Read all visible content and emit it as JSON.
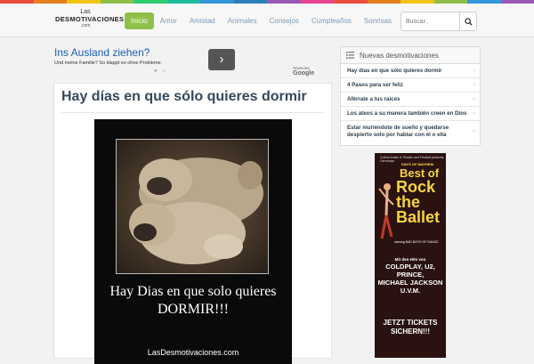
{
  "brand_stripe_colors": [
    "#e74c3c",
    "#e67e22",
    "#f1c40f",
    "#8fc04b",
    "#2ecc71",
    "#1abc9c",
    "#3498db",
    "#2980b9",
    "#9b59b6",
    "#e84393",
    "#e74c3c",
    "#e67e22",
    "#f1c40f",
    "#8fc04b",
    "#3498db",
    "#9b59b6"
  ],
  "header": {
    "logo": {
      "line1": "Las",
      "line2": "DESMOTIVACIONES",
      "line3": ".com"
    },
    "nav": [
      "Inicio",
      "Amor",
      "Amistad",
      "Animales",
      "Consejos",
      "Cumpleaños",
      "Sonrisas"
    ],
    "active_nav_color": "#8fc04b",
    "search_placeholder": "Buscar.."
  },
  "ad_top": {
    "headline": "Ins Ausland ziehen?",
    "subtext": "Und meine Familie? So klappt es ohne Probleme.",
    "arrow": "›",
    "dots": "● ○",
    "by_label": "Anuncios",
    "by_brand": "Google"
  },
  "post": {
    "title": "Hay días en que sólo quieres dormir",
    "caption_line1": "Hay Dias en que solo quieres",
    "caption_line2": "DORMIR!!!",
    "site": "LasDesmotivaciones.com"
  },
  "sidebar": {
    "heading": "Nuevas desmotivaciones",
    "items": [
      "Hay días en que sólo quieres dormir",
      "4 Pasos para ser feliz",
      "Aférrate a tus raices",
      "Los ateos a su manera también creen en Dios",
      "Estar muriéndote de sueño y quedarse despierto solo por hablar con él o ella"
    ]
  },
  "ad_side": {
    "top_line": "Collins Artists & Theater and Festival presents Germanys",
    "show": "DAYS OF MAYHEM",
    "best": "Best of",
    "title_lines": [
      "Rock",
      "the",
      "Ballet"
    ],
    "starring": "starring BAD BOYS OF DANCE",
    "with": "Mit den Hits von",
    "acts": [
      "COLDPLAY, U2,",
      "PRINCE,",
      "MICHAEL JACKSON",
      "U.V.M."
    ],
    "tickets": [
      "JETZT TICKETS",
      "SICHERN!!!"
    ]
  }
}
